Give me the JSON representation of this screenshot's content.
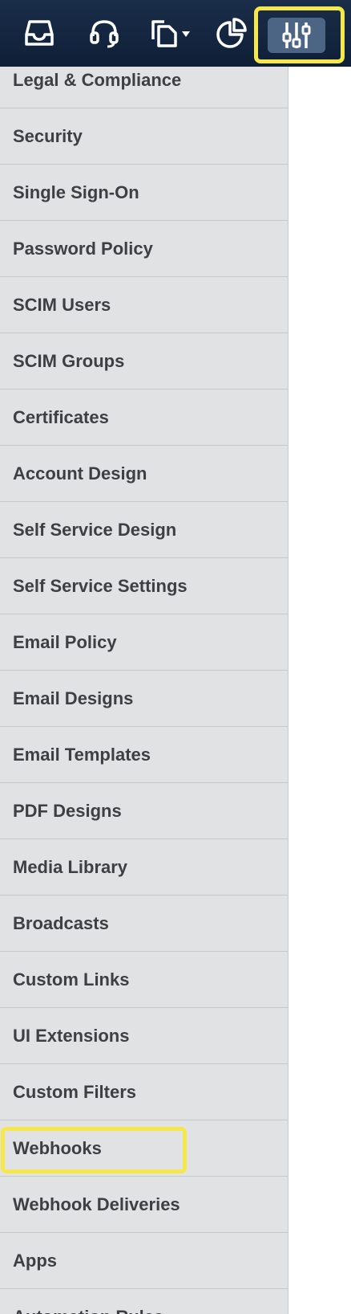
{
  "toolbar": {
    "buttons": [
      {
        "name": "inbox-button",
        "icon": "inbox-icon"
      },
      {
        "name": "support-button",
        "icon": "headset-icon"
      },
      {
        "name": "documents-button",
        "icon": "documents-dropdown-icon"
      },
      {
        "name": "reports-button",
        "icon": "pie-chart-icon"
      },
      {
        "name": "settings-button",
        "icon": "sliders-icon",
        "active": true
      }
    ],
    "active_highlight_color": "#f6e84a"
  },
  "sidebar": {
    "items": [
      {
        "label": "Legal & Compliance"
      },
      {
        "label": "Security"
      },
      {
        "label": "Single Sign-On"
      },
      {
        "label": "Password Policy"
      },
      {
        "label": "SCIM Users"
      },
      {
        "label": "SCIM Groups"
      },
      {
        "label": "Certificates"
      },
      {
        "label": "Account Design"
      },
      {
        "label": "Self Service Design"
      },
      {
        "label": "Self Service Settings"
      },
      {
        "label": "Email Policy"
      },
      {
        "label": "Email Designs"
      },
      {
        "label": "Email Templates"
      },
      {
        "label": "PDF Designs"
      },
      {
        "label": "Media Library"
      },
      {
        "label": "Broadcasts"
      },
      {
        "label": "Custom Links"
      },
      {
        "label": "UI Extensions"
      },
      {
        "label": "Custom Filters"
      },
      {
        "label": "Webhooks",
        "highlighted": true
      },
      {
        "label": "Webhook Deliveries"
      },
      {
        "label": "Apps"
      },
      {
        "label": "Automation Rules"
      }
    ]
  },
  "colors": {
    "topbar": "#13243e",
    "sidebar_bg": "#e1e2e4",
    "highlight": "#f6e84a",
    "active_tab": "#4d6585",
    "text": "#3d3f43"
  }
}
